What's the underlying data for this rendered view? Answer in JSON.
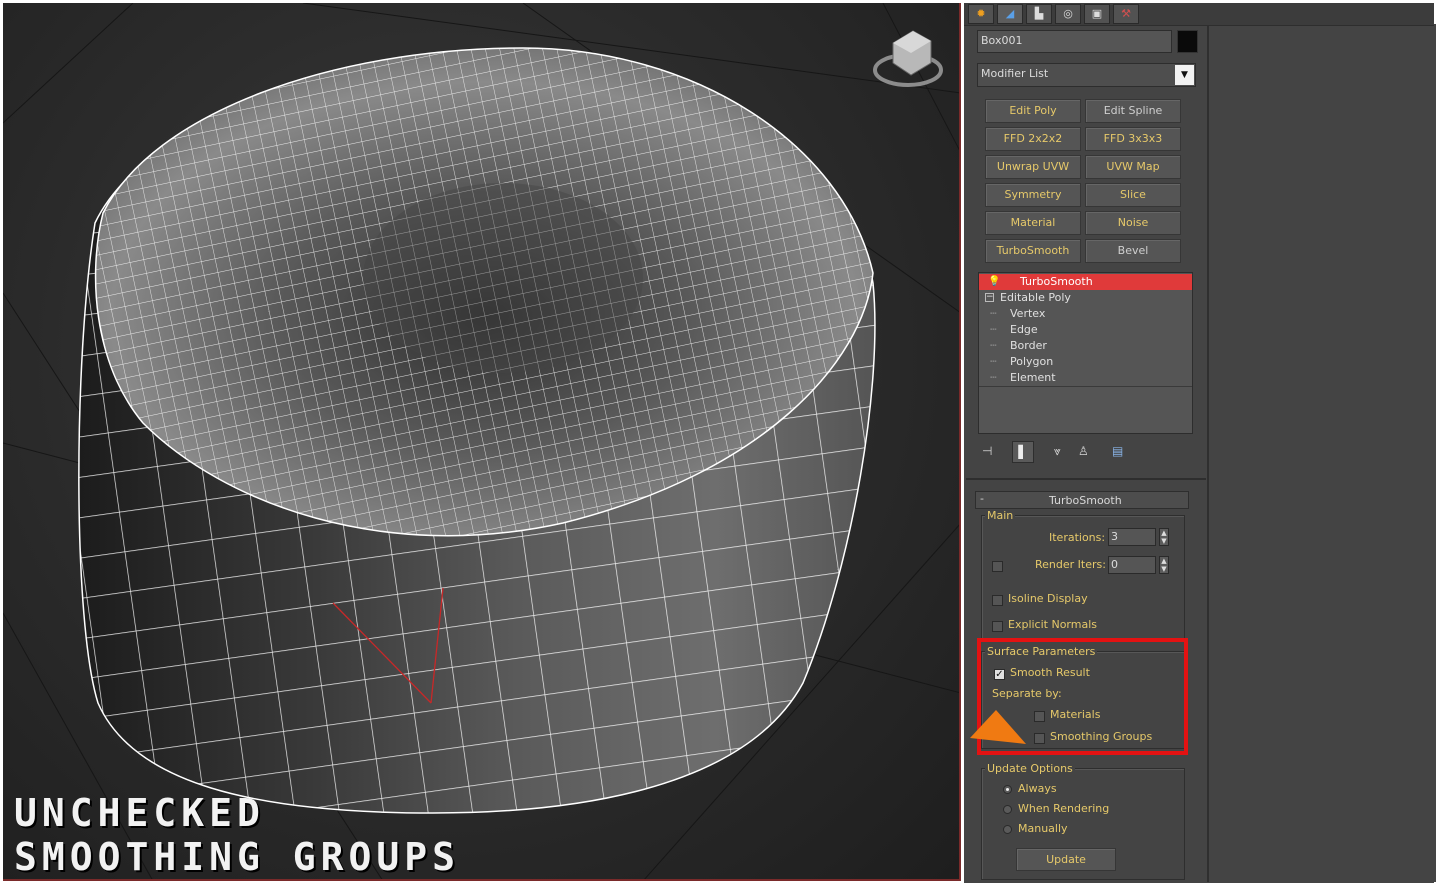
{
  "viewport": {
    "caption_line1": "UNCHECKED",
    "caption_line2": "SMOOTHING GROUPS",
    "object_label": "Box001"
  },
  "command_panel": {
    "tabs": [
      "create-icon",
      "modify-icon",
      "hierarchy-icon",
      "motion-icon",
      "display-icon",
      "utilities-icon"
    ],
    "object_name": "Box001",
    "object_color": "#0a0a0a",
    "modifier_list": "Modifier List",
    "modifier_buttons": [
      {
        "label": "Edit Poly",
        "highlight": true
      },
      {
        "label": "Edit Spline",
        "highlight": false
      },
      {
        "label": "FFD 2x2x2",
        "highlight": true
      },
      {
        "label": "FFD 3x3x3",
        "highlight": true
      },
      {
        "label": "Unwrap UVW",
        "highlight": true
      },
      {
        "label": "UVW Map",
        "highlight": true
      },
      {
        "label": "Symmetry",
        "highlight": true
      },
      {
        "label": "Slice",
        "highlight": true
      },
      {
        "label": "Material",
        "highlight": true
      },
      {
        "label": "Noise",
        "highlight": true
      },
      {
        "label": "TurboSmooth",
        "highlight": true
      },
      {
        "label": "Bevel",
        "highlight": false
      }
    ],
    "stack": {
      "selected": "TurboSmooth",
      "base": "Editable Poly",
      "sub_objects": [
        "Vertex",
        "Edge",
        "Border",
        "Polygon",
        "Element"
      ]
    },
    "rollout": {
      "title": "TurboSmooth",
      "main_group": "Main",
      "iterations_label": "Iterations:",
      "iterations_value": "3",
      "render_iters_label": "Render Iters:",
      "render_iters_value": "0",
      "isoline_label": "Isoline Display",
      "explicit_label": "Explicit Normals",
      "surface_group": "Surface Parameters",
      "smooth_result_label": "Smooth Result",
      "smooth_result_checked": true,
      "separate_by_label": "Separate by:",
      "materials_label": "Materials",
      "smoothing_groups_label": "Smoothing Groups",
      "update_group": "Update Options",
      "always_label": "Always",
      "when_rendering_label": "When Rendering",
      "manually_label": "Manually",
      "update_button": "Update"
    },
    "highlight_color": "#e41212",
    "arrow_color": "#f07a12"
  }
}
